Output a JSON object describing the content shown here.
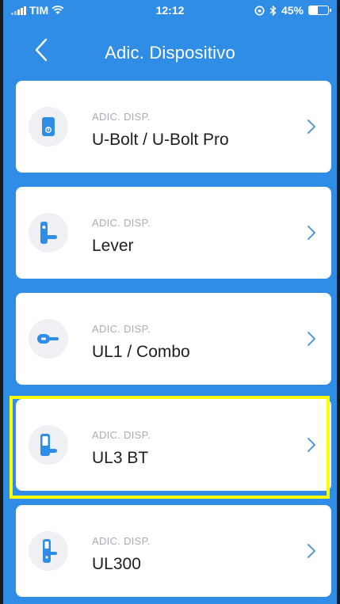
{
  "status_bar": {
    "carrier": "TIM",
    "time": "12:12",
    "battery_percent_label": "45%",
    "battery_level": 0.45
  },
  "nav": {
    "back_icon": "chevron-left-icon",
    "title": "Adic. Dispositivo"
  },
  "devices": [
    {
      "sublabel": "ADIC. DISP.",
      "label": "U-Bolt / U-Bolt Pro",
      "icon": "deadbolt-lock-icon"
    },
    {
      "sublabel": "ADIC. DISP.",
      "label": "Lever",
      "icon": "lever-lock-icon"
    },
    {
      "sublabel": "ADIC. DISP.",
      "label": "UL1 / Combo",
      "icon": "combo-lock-icon"
    },
    {
      "sublabel": "ADIC. DISP.",
      "label": "UL3 BT",
      "icon": "ul3-lock-icon"
    },
    {
      "sublabel": "ADIC. DISP.",
      "label": "UL300",
      "icon": "ul300-lock-icon"
    }
  ],
  "colors": {
    "background": "#2f8de6",
    "accent": "#2f8de6",
    "card": "#ffffff",
    "highlight": "#ffff00"
  }
}
